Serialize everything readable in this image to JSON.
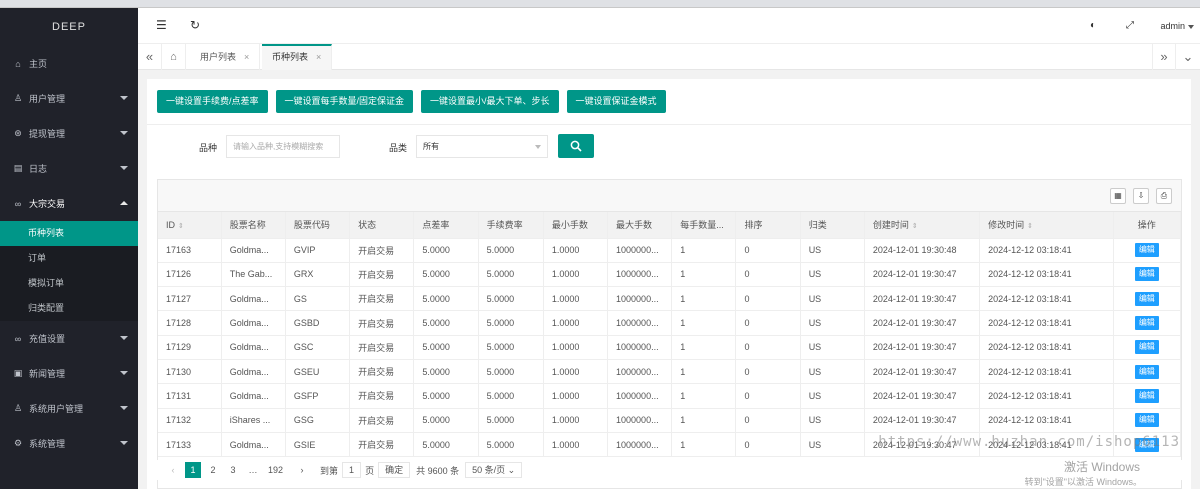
{
  "sidebar": {
    "logo": "DEEP",
    "items": [
      {
        "icon": "⌂",
        "label": "主页",
        "caret": false
      },
      {
        "icon": "♙",
        "label": "用户管理",
        "caret": true
      },
      {
        "icon": "⊛",
        "label": "提现管理",
        "caret": true
      },
      {
        "icon": "▤",
        "label": "日志",
        "caret": true
      },
      {
        "icon": "∞",
        "label": "大宗交易",
        "caret": true,
        "open": true
      }
    ],
    "sub_items": [
      "币种列表",
      "订单",
      "模拟订单",
      "归类配置"
    ],
    "items_after": [
      {
        "icon": "∞",
        "label": "充值设置"
      },
      {
        "icon": "▣",
        "label": "新闻管理"
      },
      {
        "icon": "♙",
        "label": "系统用户管理"
      },
      {
        "icon": "⚙",
        "label": "系统管理"
      }
    ]
  },
  "topbar": {
    "menu_icon": "☰",
    "refresh_icon": "↻",
    "theme_icon": "◐",
    "fullscreen_icon": "⤢",
    "user": "admin"
  },
  "tabs": {
    "home_icon": "⌂",
    "items": [
      {
        "label": "用户列表",
        "close": "×"
      },
      {
        "label": "币种列表",
        "close": "×"
      }
    ],
    "left_ctrl": "«",
    "right_ctrl": "»",
    "dropdown": "⌄"
  },
  "actions": [
    "一键设置手续费/点差率",
    "一键设置每手数量/固定保证金",
    "一键设置最小/最大下单、步长",
    "一键设置保证金模式"
  ],
  "filters": {
    "name_label": "品种",
    "name_placeholder": "请输入品种,支持模糊搜索",
    "category_label": "品类",
    "category_value": "所有"
  },
  "toolbar_icons": [
    "▦",
    "⇩",
    "⎙"
  ],
  "table": {
    "headers": [
      "ID",
      "股票名称",
      "股票代码",
      "状态",
      "点差率",
      "手续费率",
      "最小手数",
      "最大手数",
      "每手数量...",
      "排序",
      "归类",
      "创建时间",
      "修改时间",
      "操作"
    ],
    "rows": [
      [
        "17163",
        "Goldma...",
        "GVIP",
        "开启交易",
        "5.0000",
        "5.0000",
        "1.0000",
        "1000000...",
        "1",
        "0",
        "US",
        "2024-12-01 19:30:48",
        "2024-12-12 03:18:41",
        "编辑"
      ],
      [
        "17126",
        "The Gab...",
        "GRX",
        "开启交易",
        "5.0000",
        "5.0000",
        "1.0000",
        "1000000...",
        "1",
        "0",
        "US",
        "2024-12-01 19:30:47",
        "2024-12-12 03:18:41",
        "编辑"
      ],
      [
        "17127",
        "Goldma...",
        "GS",
        "开启交易",
        "5.0000",
        "5.0000",
        "1.0000",
        "1000000...",
        "1",
        "0",
        "US",
        "2024-12-01 19:30:47",
        "2024-12-12 03:18:41",
        "编辑"
      ],
      [
        "17128",
        "Goldma...",
        "GSBD",
        "开启交易",
        "5.0000",
        "5.0000",
        "1.0000",
        "1000000...",
        "1",
        "0",
        "US",
        "2024-12-01 19:30:47",
        "2024-12-12 03:18:41",
        "编辑"
      ],
      [
        "17129",
        "Goldma...",
        "GSC",
        "开启交易",
        "5.0000",
        "5.0000",
        "1.0000",
        "1000000...",
        "1",
        "0",
        "US",
        "2024-12-01 19:30:47",
        "2024-12-12 03:18:41",
        "编辑"
      ],
      [
        "17130",
        "Goldma...",
        "GSEU",
        "开启交易",
        "5.0000",
        "5.0000",
        "1.0000",
        "1000000...",
        "1",
        "0",
        "US",
        "2024-12-01 19:30:47",
        "2024-12-12 03:18:41",
        "编辑"
      ],
      [
        "17131",
        "Goldma...",
        "GSFP",
        "开启交易",
        "5.0000",
        "5.0000",
        "1.0000",
        "1000000...",
        "1",
        "0",
        "US",
        "2024-12-01 19:30:47",
        "2024-12-12 03:18:41",
        "编辑"
      ],
      [
        "17132",
        "iShares ...",
        "GSG",
        "开启交易",
        "5.0000",
        "5.0000",
        "1.0000",
        "1000000...",
        "1",
        "0",
        "US",
        "2024-12-01 19:30:47",
        "2024-12-12 03:18:41",
        "编辑"
      ],
      [
        "17133",
        "Goldma...",
        "GSIE",
        "开启交易",
        "5.0000",
        "5.0000",
        "1.0000",
        "1000000...",
        "1",
        "0",
        "US",
        "2024-12-01 19:30:47",
        "2024-12-12 03:18:41",
        "编辑"
      ]
    ]
  },
  "pager": {
    "prev": "‹",
    "pages": [
      "1",
      "2",
      "3",
      "…",
      "192"
    ],
    "next": "›",
    "goto_label": "到第",
    "goto_value": "1",
    "page_unit": "页",
    "confirm": "确定",
    "total": "共 9600 条",
    "page_size": "50 条/页"
  },
  "watermark": "https://www.huzhan.com/ishop6113",
  "windows": {
    "line1": "激活 Windows",
    "line2": "转到\"设置\"以激活 Windows。"
  },
  "colors": {
    "accent": "#009688",
    "sidebar": "#20222a",
    "edit": "#1e9fff"
  }
}
